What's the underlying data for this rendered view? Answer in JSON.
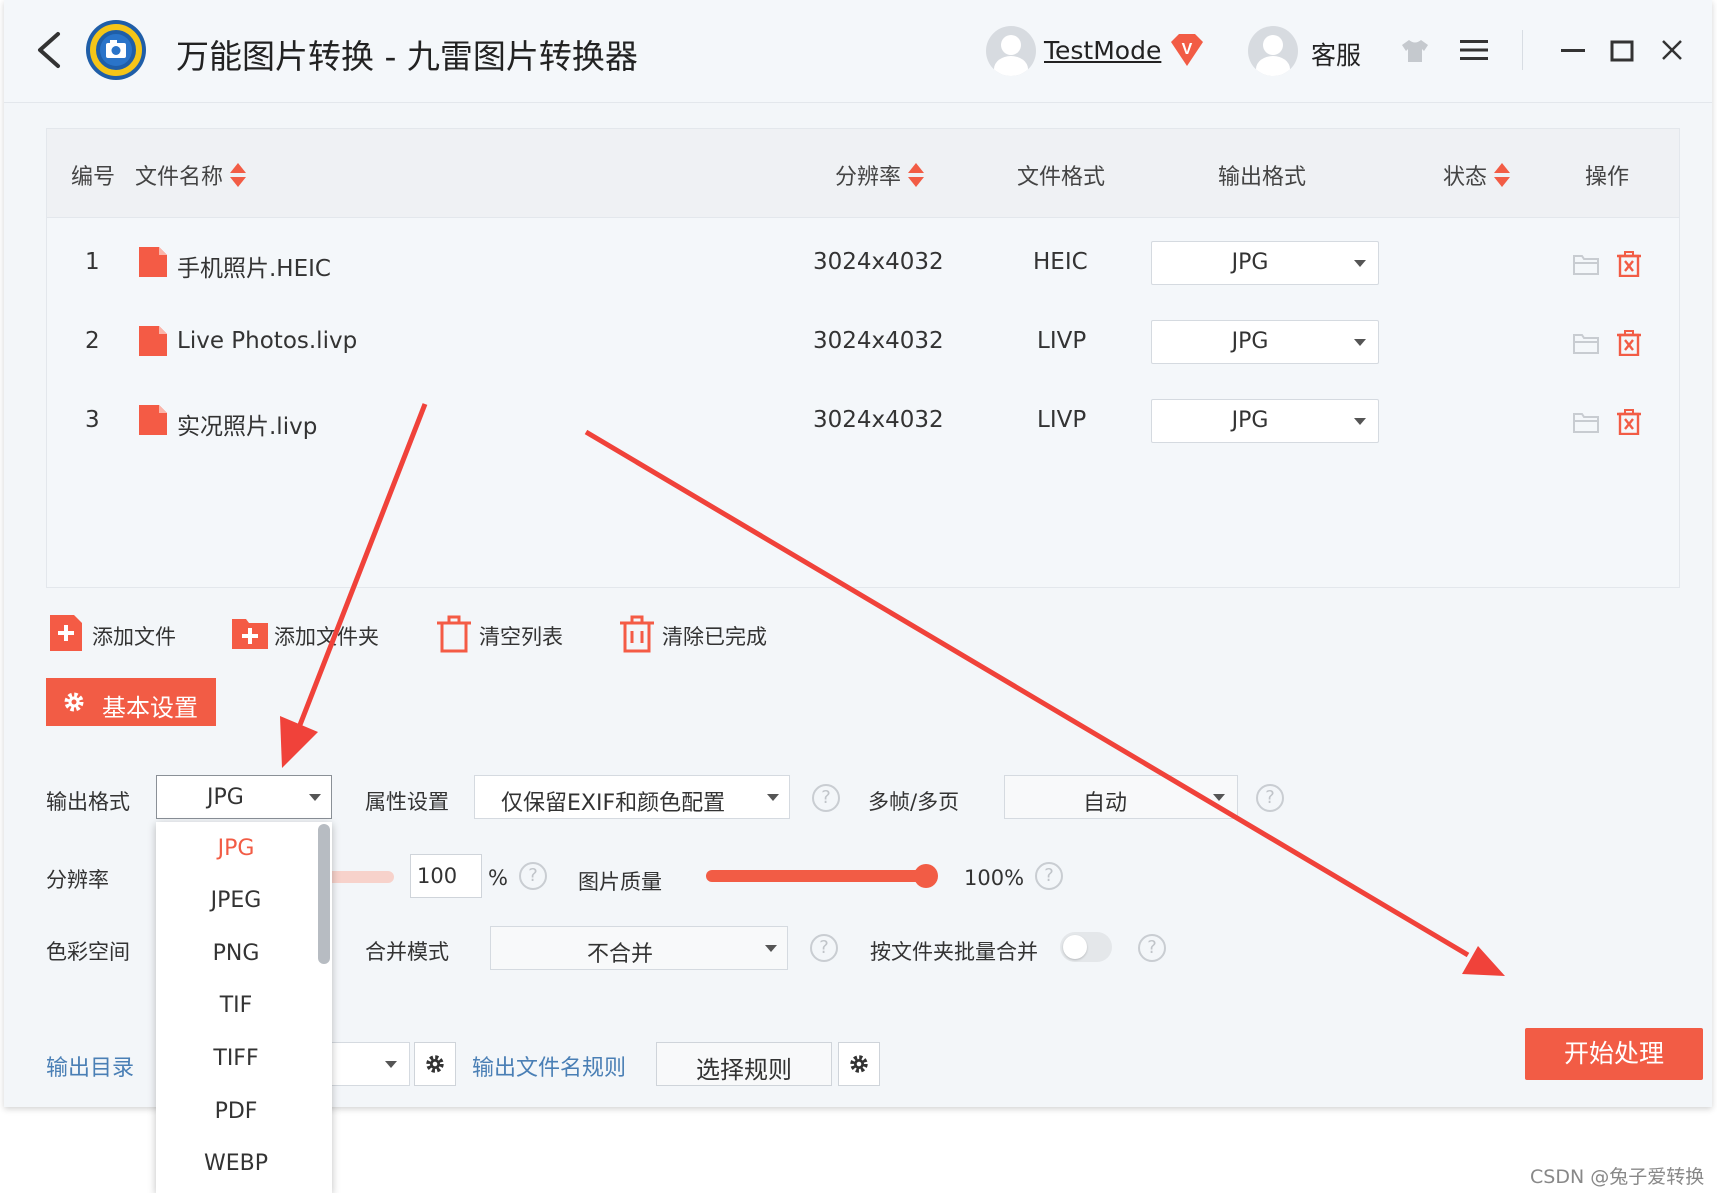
{
  "titlebar": {
    "app_title": "万能图片转换 - 九雷图片转换器",
    "username": "TestMode",
    "service_label": "客服",
    "vip_badge": "V"
  },
  "table": {
    "headers": {
      "index": "编号",
      "filename": "文件名称",
      "resolution": "分辨率",
      "file_format": "文件格式",
      "output_format": "输出格式",
      "status": "状态",
      "operation": "操作"
    },
    "rows": [
      {
        "index": "1",
        "name": "手机照片.HEIC",
        "resolution": "3024x4032",
        "format": "HEIC",
        "output": "JPG"
      },
      {
        "index": "2",
        "name": "Live Photos.livp",
        "resolution": "3024x4032",
        "format": "LIVP",
        "output": "JPG"
      },
      {
        "index": "3",
        "name": "实况照片.livp",
        "resolution": "3024x4032",
        "format": "LIVP",
        "output": "JPG"
      }
    ]
  },
  "actions": {
    "add_file": "添加文件",
    "add_folder": "添加文件夹",
    "clear_list": "清空列表",
    "clear_done": "清除已完成"
  },
  "settings": {
    "tab_label": "基本设置",
    "output_format_label": "输出格式",
    "output_format_value": "JPG",
    "attr_label": "属性设置",
    "attr_value": "仅保留EXIF和颜色配置",
    "multiframe_label": "多帧/多页",
    "multiframe_value": "自动",
    "resolution_label": "分辨率",
    "resolution_value": "100",
    "percent_sign": "%",
    "quality_label": "图片质量",
    "quality_value": "100%",
    "color_space_label": "色彩空间",
    "merge_mode_label": "合并模式",
    "merge_mode_value": "不合并",
    "merge_by_folder_label": "按文件夹批量合并",
    "output_dir_label": "输出目录",
    "filename_rule_label": "输出文件名规则",
    "select_rule_button": "选择规则",
    "start_button": "开始处理"
  },
  "format_dropdown": {
    "options": [
      "JPG",
      "JPEG",
      "PNG",
      "TIF",
      "TIFF",
      "PDF",
      "WEBP"
    ],
    "selected": "JPG"
  },
  "colors": {
    "accent": "#f25c45",
    "link": "#4a7fb5"
  },
  "watermark": "CSDN @兔子爱转换"
}
